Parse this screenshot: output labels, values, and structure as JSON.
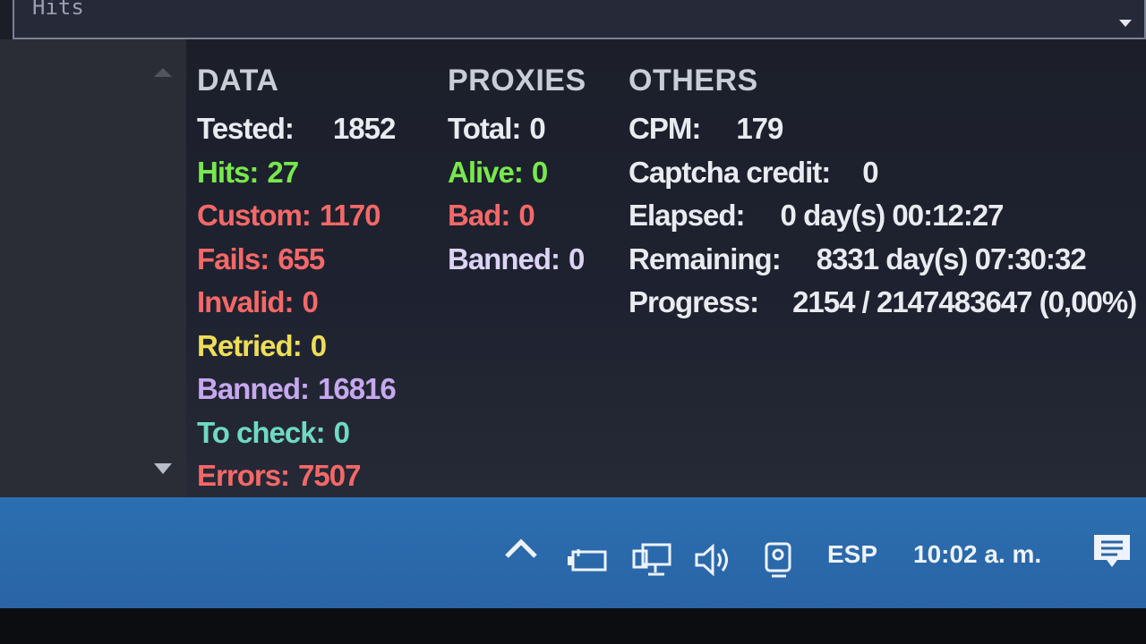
{
  "header": {
    "dropdown_value": "Hits"
  },
  "data": {
    "heading": "DATA",
    "tested": {
      "label": "Tested:",
      "value": "1852"
    },
    "hits": {
      "label": "Hits:",
      "value": "27"
    },
    "custom": {
      "label": "Custom:",
      "value": "1170"
    },
    "fails": {
      "label": "Fails:",
      "value": "655"
    },
    "invalid": {
      "label": "Invalid:",
      "value": "0"
    },
    "retried": {
      "label": "Retried:",
      "value": "0"
    },
    "banned": {
      "label": "Banned:",
      "value": "16816"
    },
    "to_check": {
      "label": "To check:",
      "value": "0"
    },
    "errors": {
      "label": "Errors:",
      "value": "7507"
    }
  },
  "proxies": {
    "heading": "PROXIES",
    "total": {
      "label": "Total:",
      "value": "0"
    },
    "alive": {
      "label": "Alive:",
      "value": "0"
    },
    "bad": {
      "label": "Bad:",
      "value": "0"
    },
    "banned": {
      "label": "Banned:",
      "value": "0"
    }
  },
  "others": {
    "heading": "OTHERS",
    "cpm": {
      "label": "CPM:",
      "value": "179"
    },
    "captcha": {
      "label": "Captcha credit:",
      "value": "0"
    },
    "elapsed": {
      "label": "Elapsed:",
      "value": "0 day(s) 00:12:27"
    },
    "remaining": {
      "label": "Remaining:",
      "value": "8331 day(s) 07:30:32"
    },
    "progress": {
      "label": "Progress:",
      "value": "2154 / 2147483647 (0,00%)"
    }
  },
  "taskbar": {
    "language": "ESP",
    "clock": "10:02 a. m.",
    "icons": [
      "chevron-up-icon",
      "battery-icon",
      "network-icon",
      "volume-icon",
      "meet-now-icon",
      "notification-icon"
    ]
  },
  "colors": {
    "hits": "#78e84c",
    "custom": "#f46868",
    "fails": "#f46868",
    "invalid": "#f46868",
    "retried": "#eede57",
    "banned": "#c6a8ee",
    "to_check": "#6fd9c4",
    "errors": "#f46868",
    "taskbar": "#2b6fb0"
  }
}
